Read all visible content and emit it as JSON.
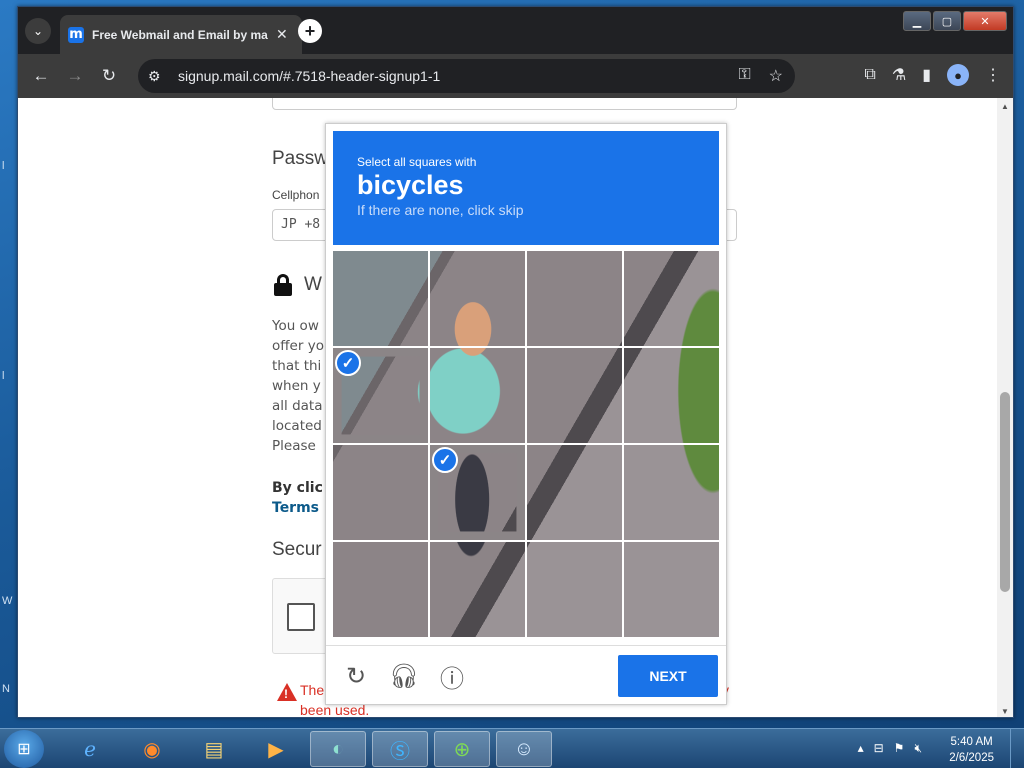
{
  "browser": {
    "tab_title": "Free Webmail and Email by ma",
    "tab_favicon": "m",
    "url": "signup.mail.com/#.7518-header-signup1-1"
  },
  "page": {
    "password_heading": "Passw",
    "cellphone_label": "Cellphon",
    "cellphone_value": "JP +8",
    "we_heading": "W",
    "paragraph_lines": [
      "You ow",
      "offer yo",
      "that thi",
      "when y",
      "all data",
      "located",
      "Please"
    ],
    "by_click": "By clic",
    "terms": "Terms",
    "security_heading": "Secur",
    "error_line1": "The",
    "error_line1_end": "y",
    "error_line2": "been used."
  },
  "captcha": {
    "instruction": "Select all squares with",
    "target": "bicycles",
    "skip_hint": "If there are none, click skip",
    "next_label": "NEXT",
    "selected_tiles": [
      4,
      9
    ]
  },
  "taskbar": {
    "time": "5:40 AM",
    "date": "2/6/2025"
  }
}
